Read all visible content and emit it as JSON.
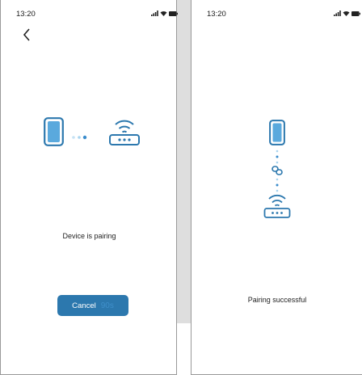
{
  "screens": [
    {
      "status_bar": {
        "time": "13:20"
      },
      "message": "Device is pairing",
      "cancel_button": {
        "label": "Cancel",
        "countdown": "90s"
      }
    },
    {
      "status_bar": {
        "time": "13:20"
      },
      "message": "Pairing successful"
    }
  ],
  "colors": {
    "accent": "#2c78ae",
    "phone_fill": "#5aa9dd",
    "dots": "#a8d4ef"
  },
  "icons": [
    "back-chevron-icon",
    "phone-icon",
    "router-icon",
    "link-icon",
    "signal-icon",
    "wifi-icon",
    "battery-icon"
  ]
}
